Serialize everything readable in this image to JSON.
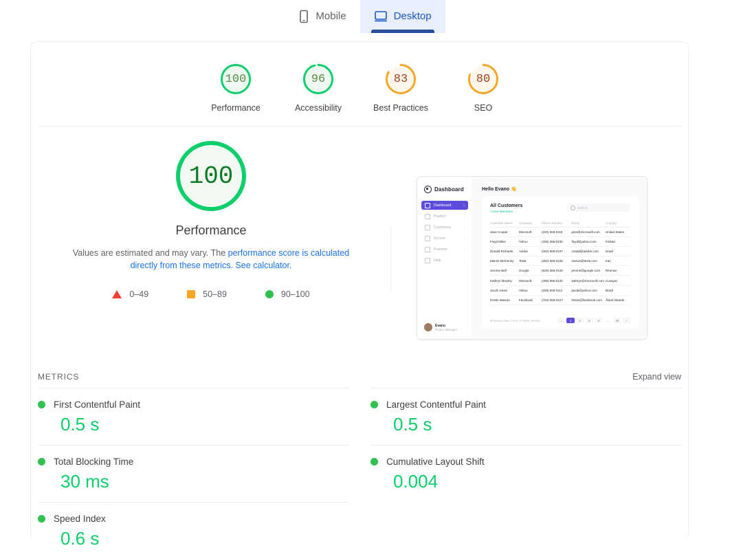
{
  "tabs": [
    {
      "label": "Mobile",
      "icon": "mobile-icon",
      "active": false
    },
    {
      "label": "Desktop",
      "icon": "desktop-icon",
      "active": true
    }
  ],
  "category_scores": [
    {
      "label": "Performance",
      "value": "100",
      "pct": 100,
      "color": "#0cce6b",
      "text_color": "#5a8a4a",
      "fill": "#eff8ef"
    },
    {
      "label": "Accessibility",
      "value": "96",
      "pct": 96,
      "color": "#0cce6b",
      "text_color": "#5a8a4a",
      "fill": "#eff8ef"
    },
    {
      "label": "Best Practices",
      "value": "83",
      "pct": 83,
      "color": "#f5a623",
      "text_color": "#9c4221",
      "fill": "#fdf6ec"
    },
    {
      "label": "SEO",
      "value": "80",
      "pct": 80,
      "color": "#f5a623",
      "text_color": "#9c4221",
      "fill": "#fdf6ec"
    }
  ],
  "performance": {
    "score": "100",
    "pct": 100,
    "title": "Performance",
    "desc_part1": "Values are estimated and may vary. The ",
    "desc_link1": "performance score is calculated directly from these metrics.",
    "desc_link2": "See calculator.",
    "legend": [
      {
        "marker": "triangle",
        "range": "0–49",
        "color": "#ef4136"
      },
      {
        "marker": "square",
        "range": "50–89",
        "color": "#f5a623"
      },
      {
        "marker": "circle",
        "range": "90–100",
        "color": "#30c14f"
      }
    ]
  },
  "metrics": {
    "section_label": "METRICS",
    "expand_label": "Expand view",
    "items": [
      {
        "name": "First Contentful Paint",
        "value": "0.5 s",
        "status": "good"
      },
      {
        "name": "Largest Contentful Paint",
        "value": "0.5 s",
        "status": "good"
      },
      {
        "name": "Total Blocking Time",
        "value": "30 ms",
        "status": "good"
      },
      {
        "name": "Cumulative Layout Shift",
        "value": "0.004",
        "status": "good"
      },
      {
        "name": "Speed Index",
        "value": "0.6 s",
        "status": "good"
      }
    ]
  },
  "screenshot": {
    "brand": "Dashboard",
    "nav": [
      {
        "label": "Dashboard",
        "active": true
      },
      {
        "label": "Product",
        "active": false
      },
      {
        "label": "Customers",
        "active": false
      },
      {
        "label": "Income",
        "active": false
      },
      {
        "label": "Promote",
        "active": false
      },
      {
        "label": "Help",
        "active": false
      }
    ],
    "user_name": "Evano",
    "user_role": "Project Manager",
    "greeting": "Hello Evano 👋",
    "panel_title": "All Customers",
    "panel_subtitle": "Active Members",
    "search_placeholder": "Search",
    "columns": [
      "Customer Name",
      "Company",
      "Phone Number",
      "Email",
      "Country"
    ],
    "rows": [
      [
        "Jane Cooper",
        "Microsoft",
        "(225) 555-0118",
        "jane@microsoft.com",
        "United States"
      ],
      [
        "Floyd Miles",
        "Yahoo",
        "(205) 555-0100",
        "floyd@yahoo.com",
        "Kiribati"
      ],
      [
        "Ronald Richards",
        "Adobe",
        "(302) 555-0107",
        "ronald@adobe.com",
        "Israel"
      ],
      [
        "Marvin McKinney",
        "Tesla",
        "(252) 555-0126",
        "marvin@tesla.com",
        "Iran"
      ],
      [
        "Jerome Bell",
        "Google",
        "(629) 555-0129",
        "jerome@google.com",
        "Réunion"
      ],
      [
        "Kathryn Murphy",
        "Microsoft",
        "(406) 555-0120",
        "kathryn@microsoft.com",
        "Curaçao"
      ],
      [
        "Jacob Jones",
        "Yahoo",
        "(208) 555-0112",
        "jacob@yahoo.com",
        "Brazil"
      ],
      [
        "Kristin Watson",
        "Facebook",
        "(704) 555-0127",
        "kristin@facebook.com",
        "Åland Islands"
      ]
    ],
    "footer_note": "Showing data 1 to 8 of 256K entries",
    "pagination": [
      "‹",
      "1",
      "2",
      "3",
      "4",
      "…",
      "40",
      "›"
    ],
    "active_page": "1"
  }
}
